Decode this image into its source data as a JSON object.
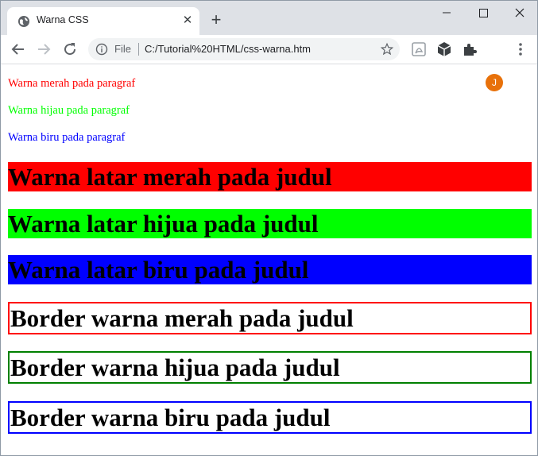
{
  "browser": {
    "tab": {
      "title": "Warna CSS",
      "close_glyph": "✕",
      "icon": "globe-icon"
    },
    "new_tab_glyph": "+",
    "window_controls": {
      "minimize": "—",
      "maximize": "☐",
      "close": "✕"
    },
    "omnibox": {
      "scheme_label": "File",
      "url": "C:/Tutorial%20HTML/css-warna.htm"
    },
    "profile_initial": "J"
  },
  "page": {
    "paragraphs": [
      {
        "text": "Warna merah pada paragraf",
        "color": "#ff0000"
      },
      {
        "text": "Warna hijau pada paragraf",
        "color": "#00ff00"
      },
      {
        "text": "Warna biru pada paragraf",
        "color": "#0000ff"
      }
    ],
    "bg_headings": [
      {
        "text": "Warna latar merah pada judul",
        "bg": "#ff0000"
      },
      {
        "text": "Warna latar hijua pada judul",
        "bg": "#00ff00"
      },
      {
        "text": "Warna latar biru pada judul",
        "bg": "#0000ff"
      }
    ],
    "border_headings": [
      {
        "text": "Border warna merah pada judul",
        "border": "#ff0000"
      },
      {
        "text": "Border warna hijua pada judul",
        "border": "#008000"
      },
      {
        "text": "Border warna biru pada judul",
        "border": "#0000ff"
      }
    ]
  }
}
